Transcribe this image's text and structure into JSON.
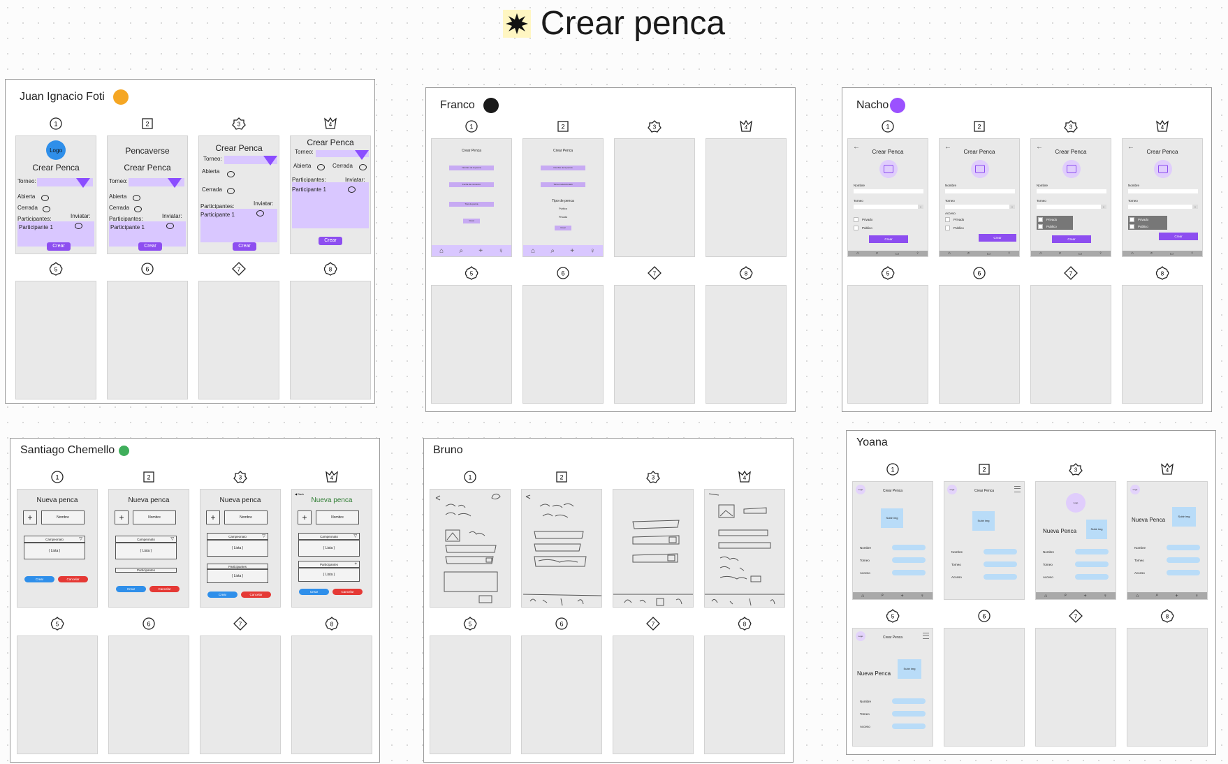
{
  "page": {
    "title": "Crear penca"
  },
  "common": {
    "crear_penca": "Crear Penca",
    "crear": "Crear",
    "cancelar": "Cancelar",
    "nueva_penca": "Nueva penca",
    "nueva_penca_cap": "Nueva Penca",
    "nombre": "Nombre",
    "torneo": "Torneo",
    "acceso": "Acceso",
    "privado": "Privado",
    "publico": "Publico",
    "campeonato": "Campeonato",
    "lista": "( Lista )",
    "participantes": "Participantes",
    "subir_img": "Subir img",
    "logo": "Logo"
  },
  "sections": {
    "jif": {
      "name": "Juan Ignacio Foti",
      "color": "#f5a623",
      "labels": {
        "logo": "Logo",
        "pencaverse": "Pencaverse",
        "torneo": "Torneo:",
        "abierta": "Abierta",
        "cerrada": "Cerrada",
        "participantes": "Participantes:",
        "inviatar": "Inviatar:",
        "participante1": "Participante 1"
      }
    },
    "franco": {
      "name": "Franco",
      "color": "#1a1a1a",
      "labels": {
        "nombre_de_la_penca": "Nombre de la penca",
        "fecha_de_comienzo": "Fecha de comienzo",
        "tipo_de_penca_small": "Tipo de penca",
        "nombre_de_la_penca2": "Nombre de la penca",
        "torneo_seleccionado": "Torneo seleccionado",
        "tipo_de_penca": "Tipo de penca",
        "publica": "Publica",
        "privada": "Privada"
      }
    },
    "nacho": {
      "name": "Nacho",
      "color": "#9b51ff"
    },
    "santiago": {
      "name": "Santiago Chemello",
      "color": "#3fae5b",
      "back": "Back"
    },
    "bruno": {
      "name": "Bruno"
    },
    "yoana": {
      "name": "Yoana"
    }
  },
  "step_icons": [
    "one-icon",
    "two-icon",
    "three-icon",
    "four-icon",
    "five-icon",
    "six-icon",
    "seven-icon",
    "eight-icon"
  ],
  "colors": {
    "purple": "#8d4ef0",
    "lavender": "#d9c7ff",
    "blue_button": "#2f8fea",
    "red_button": "#e53935",
    "light_blue": "#b9dcf8"
  }
}
